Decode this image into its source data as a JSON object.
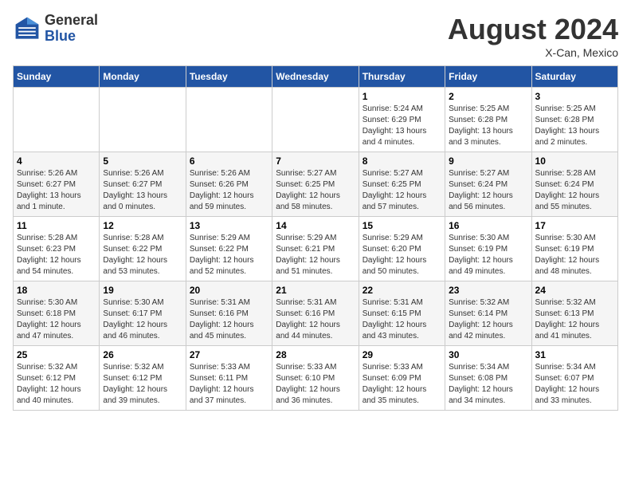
{
  "header": {
    "logo_general": "General",
    "logo_blue": "Blue",
    "month_year": "August 2024",
    "location": "X-Can, Mexico"
  },
  "weekdays": [
    "Sunday",
    "Monday",
    "Tuesday",
    "Wednesday",
    "Thursday",
    "Friday",
    "Saturday"
  ],
  "weeks": [
    [
      {
        "day": "",
        "info": ""
      },
      {
        "day": "",
        "info": ""
      },
      {
        "day": "",
        "info": ""
      },
      {
        "day": "",
        "info": ""
      },
      {
        "day": "1",
        "info": "Sunrise: 5:24 AM\nSunset: 6:29 PM\nDaylight: 13 hours\nand 4 minutes."
      },
      {
        "day": "2",
        "info": "Sunrise: 5:25 AM\nSunset: 6:28 PM\nDaylight: 13 hours\nand 3 minutes."
      },
      {
        "day": "3",
        "info": "Sunrise: 5:25 AM\nSunset: 6:28 PM\nDaylight: 13 hours\nand 2 minutes."
      }
    ],
    [
      {
        "day": "4",
        "info": "Sunrise: 5:26 AM\nSunset: 6:27 PM\nDaylight: 13 hours\nand 1 minute."
      },
      {
        "day": "5",
        "info": "Sunrise: 5:26 AM\nSunset: 6:27 PM\nDaylight: 13 hours\nand 0 minutes."
      },
      {
        "day": "6",
        "info": "Sunrise: 5:26 AM\nSunset: 6:26 PM\nDaylight: 12 hours\nand 59 minutes."
      },
      {
        "day": "7",
        "info": "Sunrise: 5:27 AM\nSunset: 6:25 PM\nDaylight: 12 hours\nand 58 minutes."
      },
      {
        "day": "8",
        "info": "Sunrise: 5:27 AM\nSunset: 6:25 PM\nDaylight: 12 hours\nand 57 minutes."
      },
      {
        "day": "9",
        "info": "Sunrise: 5:27 AM\nSunset: 6:24 PM\nDaylight: 12 hours\nand 56 minutes."
      },
      {
        "day": "10",
        "info": "Sunrise: 5:28 AM\nSunset: 6:24 PM\nDaylight: 12 hours\nand 55 minutes."
      }
    ],
    [
      {
        "day": "11",
        "info": "Sunrise: 5:28 AM\nSunset: 6:23 PM\nDaylight: 12 hours\nand 54 minutes."
      },
      {
        "day": "12",
        "info": "Sunrise: 5:28 AM\nSunset: 6:22 PM\nDaylight: 12 hours\nand 53 minutes."
      },
      {
        "day": "13",
        "info": "Sunrise: 5:29 AM\nSunset: 6:22 PM\nDaylight: 12 hours\nand 52 minutes."
      },
      {
        "day": "14",
        "info": "Sunrise: 5:29 AM\nSunset: 6:21 PM\nDaylight: 12 hours\nand 51 minutes."
      },
      {
        "day": "15",
        "info": "Sunrise: 5:29 AM\nSunset: 6:20 PM\nDaylight: 12 hours\nand 50 minutes."
      },
      {
        "day": "16",
        "info": "Sunrise: 5:30 AM\nSunset: 6:19 PM\nDaylight: 12 hours\nand 49 minutes."
      },
      {
        "day": "17",
        "info": "Sunrise: 5:30 AM\nSunset: 6:19 PM\nDaylight: 12 hours\nand 48 minutes."
      }
    ],
    [
      {
        "day": "18",
        "info": "Sunrise: 5:30 AM\nSunset: 6:18 PM\nDaylight: 12 hours\nand 47 minutes."
      },
      {
        "day": "19",
        "info": "Sunrise: 5:30 AM\nSunset: 6:17 PM\nDaylight: 12 hours\nand 46 minutes."
      },
      {
        "day": "20",
        "info": "Sunrise: 5:31 AM\nSunset: 6:16 PM\nDaylight: 12 hours\nand 45 minutes."
      },
      {
        "day": "21",
        "info": "Sunrise: 5:31 AM\nSunset: 6:16 PM\nDaylight: 12 hours\nand 44 minutes."
      },
      {
        "day": "22",
        "info": "Sunrise: 5:31 AM\nSunset: 6:15 PM\nDaylight: 12 hours\nand 43 minutes."
      },
      {
        "day": "23",
        "info": "Sunrise: 5:32 AM\nSunset: 6:14 PM\nDaylight: 12 hours\nand 42 minutes."
      },
      {
        "day": "24",
        "info": "Sunrise: 5:32 AM\nSunset: 6:13 PM\nDaylight: 12 hours\nand 41 minutes."
      }
    ],
    [
      {
        "day": "25",
        "info": "Sunrise: 5:32 AM\nSunset: 6:12 PM\nDaylight: 12 hours\nand 40 minutes."
      },
      {
        "day": "26",
        "info": "Sunrise: 5:32 AM\nSunset: 6:12 PM\nDaylight: 12 hours\nand 39 minutes."
      },
      {
        "day": "27",
        "info": "Sunrise: 5:33 AM\nSunset: 6:11 PM\nDaylight: 12 hours\nand 37 minutes."
      },
      {
        "day": "28",
        "info": "Sunrise: 5:33 AM\nSunset: 6:10 PM\nDaylight: 12 hours\nand 36 minutes."
      },
      {
        "day": "29",
        "info": "Sunrise: 5:33 AM\nSunset: 6:09 PM\nDaylight: 12 hours\nand 35 minutes."
      },
      {
        "day": "30",
        "info": "Sunrise: 5:34 AM\nSunset: 6:08 PM\nDaylight: 12 hours\nand 34 minutes."
      },
      {
        "day": "31",
        "info": "Sunrise: 5:34 AM\nSunset: 6:07 PM\nDaylight: 12 hours\nand 33 minutes."
      }
    ]
  ]
}
